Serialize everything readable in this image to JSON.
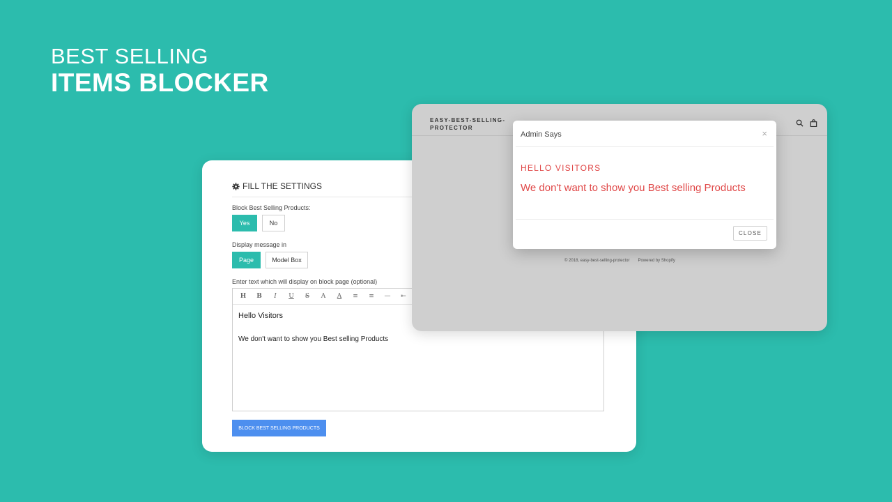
{
  "hero": {
    "line1": "BEST SELLING",
    "line2": "ITEMS BLOCKER"
  },
  "settings": {
    "title": "FILL THE SETTINGS",
    "block_label": "Block Best Selling Products:",
    "yes_label": "Yes",
    "no_label": "No",
    "display_label": "Display message in",
    "page_label": "Page",
    "modelbox_label": "Model Box",
    "editor_label": "Enter text which will display on block page (optional)",
    "toolbar": [
      "H",
      "B",
      "I",
      "U",
      "S",
      "A",
      "A",
      "≡",
      "≡",
      "—",
      "⇤"
    ],
    "editor_line1": "Hello Visitors",
    "editor_line2": "We don't want to show you Best selling Products",
    "submit_label": "BLOCK BEST SELLING PRODUCTS"
  },
  "preview": {
    "brand": "EASY-BEST-SELLING-PROTECTOR",
    "footer_copy": "© 2018, easy-best-selling-protector",
    "footer_powered": "Powered by Shopify",
    "icons": [
      "search-icon",
      "bag-icon"
    ]
  },
  "modal": {
    "header": "Admin Says",
    "close_x": "×",
    "heading": "HELLO VISITORS",
    "message": "We don't want to show you Best selling Products",
    "close_label": "CLOSE"
  },
  "colors": {
    "background": "#2cbcad",
    "accent": "#2cbcad",
    "submit": "#4d8fef",
    "modal_text": "#e04848"
  }
}
